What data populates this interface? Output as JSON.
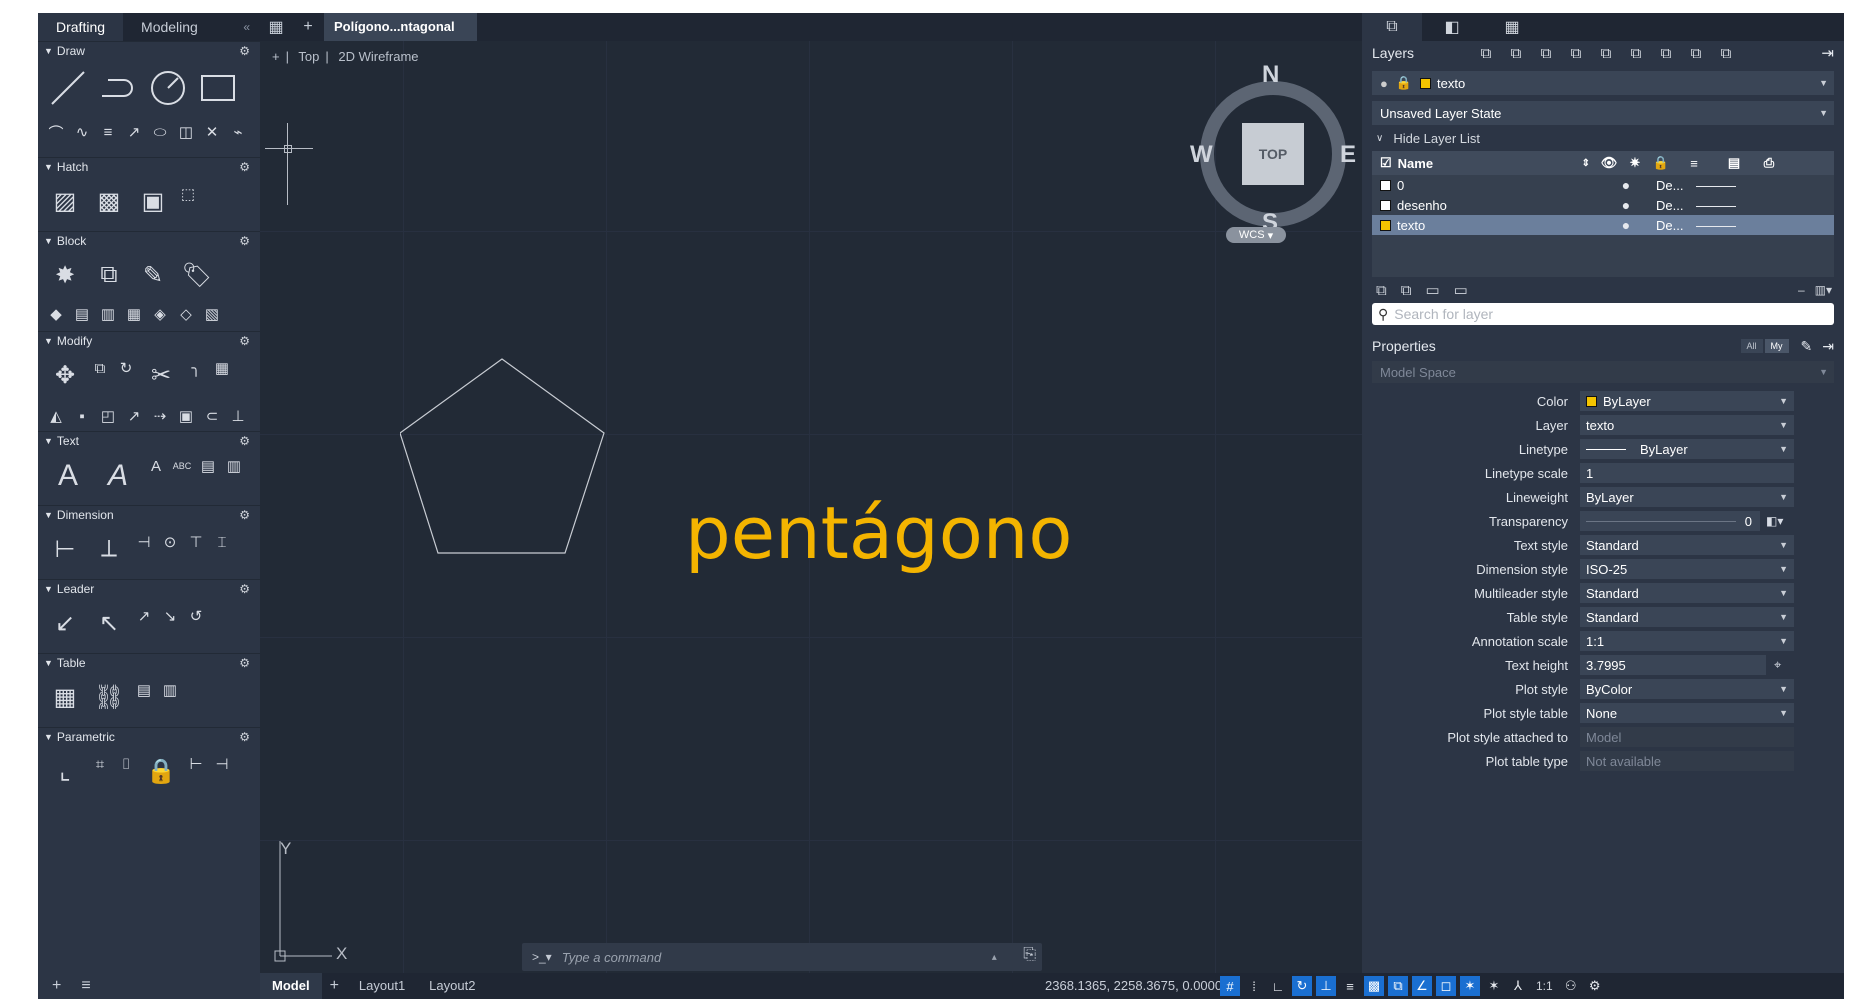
{
  "palette": {
    "tabs": [
      "Drafting",
      "Modeling"
    ],
    "sections": [
      "Draw",
      "Hatch",
      "Block",
      "Modify",
      "Text",
      "Dimension",
      "Leader",
      "Table",
      "Parametric"
    ],
    "text_tools": [
      "A",
      "A",
      "A",
      "ABC"
    ]
  },
  "document": {
    "tab": "Polígono...ntagonal"
  },
  "viewport": {
    "label": [
      "+",
      "Top",
      "2D Wireframe"
    ],
    "compass": {
      "n": "N",
      "s": "S",
      "e": "E",
      "w": "W"
    },
    "cube_face": "TOP",
    "wcs": "WCS",
    "drawing_text": "pentágono",
    "ucs": {
      "x": "X",
      "y": "Y"
    }
  },
  "command": {
    "prompt": ">_▾",
    "placeholder": "Type a command"
  },
  "status": {
    "tabs": [
      "Model",
      "Layout1",
      "Layout2"
    ],
    "coords": "2368.1365, 2258.3675, 0.0000",
    "scale": "1:1"
  },
  "layers": {
    "title": "Layers",
    "current_layer": "texto",
    "layer_state": "Unsaved Layer State",
    "hide_list": "Hide Layer List",
    "column_name": "Name",
    "rows": [
      {
        "name": "0",
        "desc": "De...",
        "color": "#ffffff"
      },
      {
        "name": "desenho",
        "desc": "De...",
        "color": "#ffffff"
      },
      {
        "name": "texto",
        "desc": "De...",
        "color": "#f4c400"
      }
    ],
    "search_placeholder": "Search for layer"
  },
  "properties": {
    "title": "Properties",
    "filter_all": "All",
    "filter_my": "My",
    "space": "Model Space",
    "rows": [
      {
        "label": "Color",
        "value": "ByLayer"
      },
      {
        "label": "Layer",
        "value": "texto"
      },
      {
        "label": "Linetype",
        "value": "ByLayer"
      },
      {
        "label": "Linetype scale",
        "value": "1"
      },
      {
        "label": "Lineweight",
        "value": "ByLayer"
      },
      {
        "label": "Transparency",
        "value": "0"
      },
      {
        "label": "Text style",
        "value": "Standard"
      },
      {
        "label": "Dimension style",
        "value": "ISO-25"
      },
      {
        "label": "Multileader style",
        "value": "Standard"
      },
      {
        "label": "Table style",
        "value": "Standard"
      },
      {
        "label": "Annotation scale",
        "value": "1:1"
      },
      {
        "label": "Text height",
        "value": "3.7995"
      },
      {
        "label": "Plot style",
        "value": "ByColor"
      },
      {
        "label": "Plot style table",
        "value": "None"
      },
      {
        "label": "Plot style attached to",
        "value": "Model"
      },
      {
        "label": "Plot table type",
        "value": "Not available"
      }
    ]
  },
  "colors": {
    "accent": "#f4b400",
    "highlight": "#1a6fd1",
    "background": "#222a36"
  }
}
